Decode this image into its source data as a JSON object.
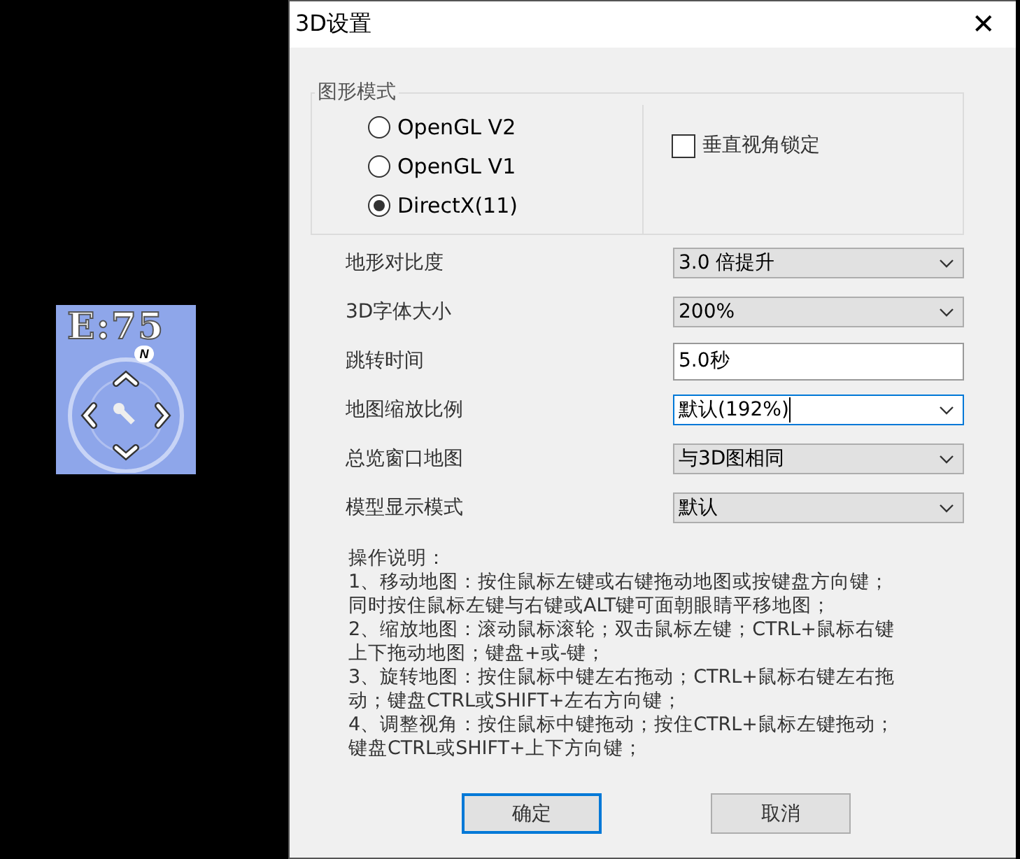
{
  "map_widget": {
    "heading": "E:75",
    "north": "N"
  },
  "dialog": {
    "title": "3D设置",
    "close": "✕",
    "graphics_mode": {
      "label": "图形模式",
      "options": [
        {
          "label": "OpenGL V2",
          "selected": false
        },
        {
          "label": "OpenGL V1",
          "selected": false
        },
        {
          "label": "DirectX(11)",
          "selected": true
        }
      ],
      "vertical_lock": {
        "label": "垂直视角锁定",
        "checked": false
      }
    },
    "settings": [
      {
        "label": "地形对比度",
        "kind": "dropdown",
        "value": "3.0 倍提升",
        "focused": false
      },
      {
        "label": "3D字体大小",
        "kind": "dropdown",
        "value": "200%",
        "focused": false
      },
      {
        "label": "跳转时间",
        "kind": "text",
        "value": "5.0秒",
        "focused": false
      },
      {
        "label": "地图缩放比例",
        "kind": "editable",
        "value": "默认(192%)",
        "focused": true
      },
      {
        "label": "总览窗口地图",
        "kind": "dropdown",
        "value": "与3D图相同",
        "focused": false
      },
      {
        "label": "模型显示模式",
        "kind": "dropdown",
        "value": "默认",
        "focused": false
      }
    ],
    "instructions": [
      "操作说明：",
      "1、移动地图：按住鼠标左键或右键拖动地图或按键盘方向键；",
      "同时按住鼠标左键与右键或ALT键可面朝眼睛平移地图；",
      "2、缩放地图：滚动鼠标滚轮；双击鼠标左键；CTRL+鼠标右键",
      "上下拖动地图；键盘+或-键；",
      "3、旋转地图：按住鼠标中键左右拖动；CTRL+鼠标右键左右拖",
      "动；键盘CTRL或SHIFT+左右方向键；",
      "4、调整视角：按住鼠标中键拖动；按住CTRL+鼠标左键拖动；",
      "键盘CTRL或SHIFT+上下方向键；"
    ],
    "buttons": [
      {
        "label": "确定",
        "default": true
      },
      {
        "label": "取消",
        "default": false
      }
    ]
  }
}
